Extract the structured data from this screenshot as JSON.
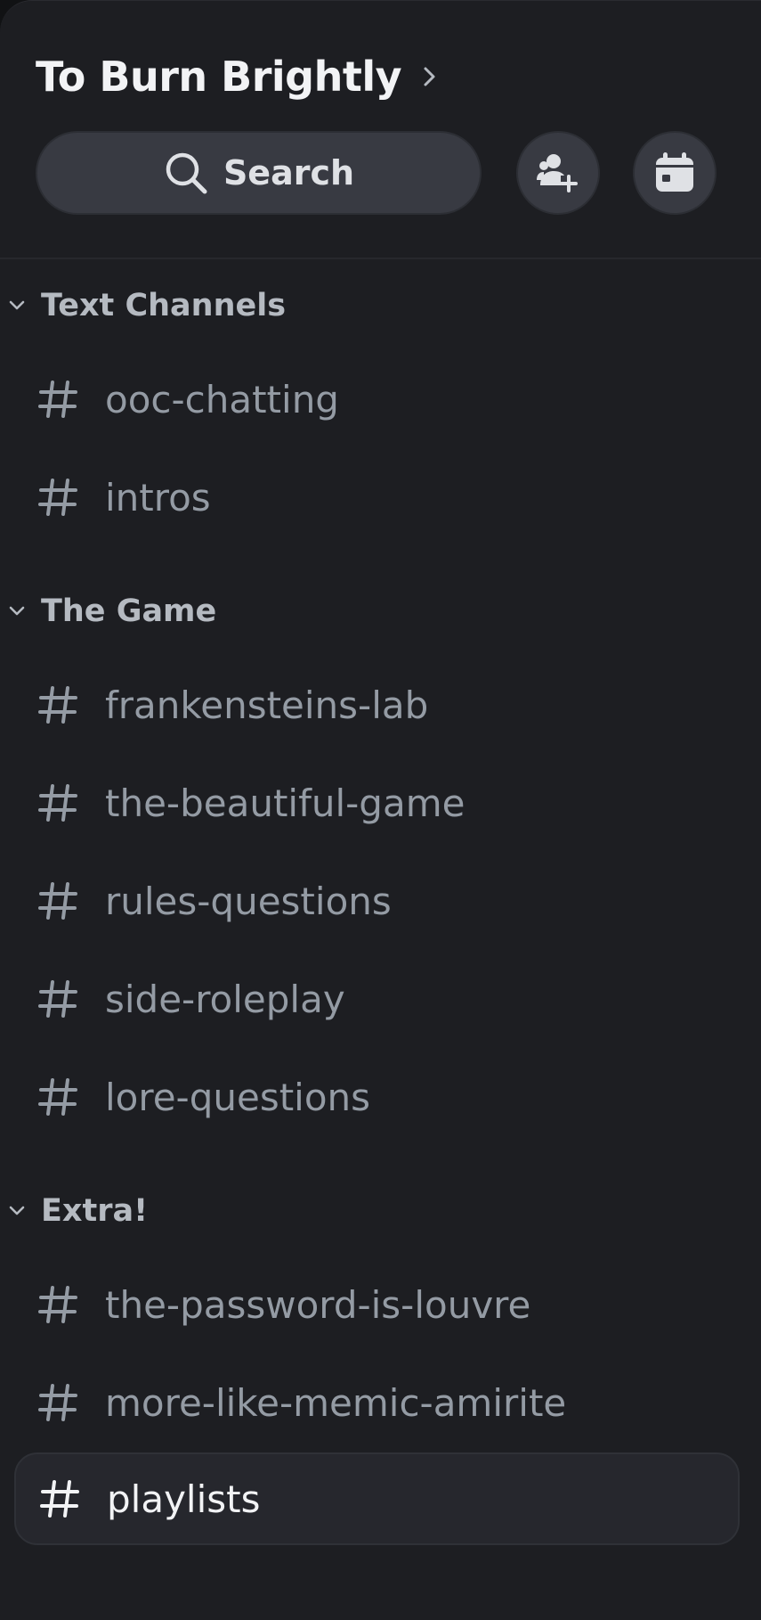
{
  "server": {
    "title": "To Burn Brightly"
  },
  "search": {
    "label": "Search"
  },
  "categories": [
    {
      "label": "Text Channels",
      "channels": [
        {
          "name": "ooc-chatting"
        },
        {
          "name": "intros"
        }
      ]
    },
    {
      "label": "The Game",
      "channels": [
        {
          "name": "frankensteins-lab"
        },
        {
          "name": "the-beautiful-game"
        },
        {
          "name": "rules-questions"
        },
        {
          "name": "side-roleplay"
        },
        {
          "name": "lore-questions"
        }
      ]
    },
    {
      "label": "Extra!",
      "channels": [
        {
          "name": "the-password-is-louvre"
        },
        {
          "name": "more-like-memic-amirite"
        },
        {
          "name": "playlists",
          "selected": true
        }
      ]
    }
  ],
  "colors": {
    "panel_bg": "#1d1e22",
    "channel_text": "#949ba4",
    "selected_text": "#f2f3f5",
    "button_bg": "#383a42"
  },
  "icons": [
    "chevron-right-icon",
    "search-icon",
    "add-member-icon",
    "calendar-icon",
    "chevron-down-icon",
    "hash-icon"
  ]
}
